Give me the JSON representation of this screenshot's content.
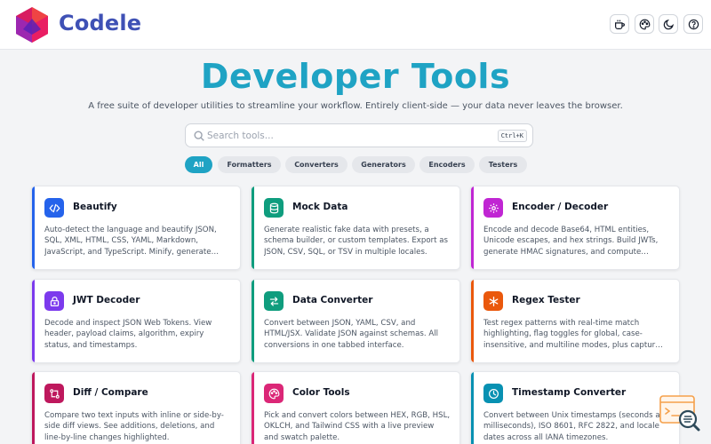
{
  "header": {
    "brand": "Codele",
    "buttons": [
      {
        "icon": "coffee-icon",
        "label": "Buy me a coffee"
      },
      {
        "icon": "palette-icon",
        "label": "Theme"
      },
      {
        "icon": "moon-icon",
        "label": "Dark mode"
      },
      {
        "icon": "help-icon",
        "label": "Help"
      }
    ]
  },
  "hero": {
    "title": "Developer Tools",
    "subtitle": "A free suite of developer utilities to streamline your workflow. Entirely client-side — your data never leaves the browser."
  },
  "search": {
    "placeholder": "Search tools...",
    "value": "",
    "shortcut": "Ctrl+K"
  },
  "filters": [
    {
      "label": "All",
      "active": true
    },
    {
      "label": "Formatters",
      "active": false
    },
    {
      "label": "Converters",
      "active": false
    },
    {
      "label": "Generators",
      "active": false
    },
    {
      "label": "Encoders",
      "active": false
    },
    {
      "label": "Testers",
      "active": false
    }
  ],
  "colors": {
    "brand": "#3f51b5",
    "accent": "#1fa3c4"
  },
  "tools": [
    {
      "name": "Beautify",
      "icon": "code-icon",
      "color": "#2563eb",
      "description": "Auto-detect the language and beautify JSON, SQL, XML, HTML, CSS, YAML, Markdown, JavaScript, and TypeScript. Minify, generate…"
    },
    {
      "name": "Mock Data",
      "icon": "database-icon",
      "color": "#0f9d7e",
      "description": "Generate realistic fake data with presets, a schema builder, or custom templates. Export as JSON, CSV, SQL, or TSV in multiple locales."
    },
    {
      "name": "Encoder / Decoder",
      "icon": "gear-icon",
      "color": "#c026d3",
      "description": "Encode and decode Base64, HTML entities, Unicode escapes, and hex strings. Build JWTs, generate HMAC signatures, and compute…"
    },
    {
      "name": "JWT Decoder",
      "icon": "lock-icon",
      "color": "#7c3aed",
      "description": "Decode and inspect JSON Web Tokens. View header, payload claims, algorithm, expiry status, and timestamps."
    },
    {
      "name": "Data Converter",
      "icon": "swap-icon",
      "color": "#0f9d7e",
      "description": "Convert between JSON, YAML, CSV, and HTML/JSX. Validate JSON against schemas. All conversions in one tabbed interface."
    },
    {
      "name": "Regex Tester",
      "icon": "asterisk-icon",
      "color": "#ea580c",
      "description": "Test regex patterns with real-time match highlighting, flag toggles for global, case-insensitive, and multiline modes, plus captur…"
    },
    {
      "name": "Diff / Compare",
      "icon": "git-compare-icon",
      "color": "#be185d",
      "description": "Compare two text inputs with inline or side-by-side diff views. See additions, deletions, and line-by-line changes highlighted."
    },
    {
      "name": "Color Tools",
      "icon": "palette-icon",
      "color": "#db2777",
      "description": "Pick and convert colors between HEX, RGB, HSL, OKLCH, and Tailwind CSS with a live preview and swatch palette."
    },
    {
      "name": "Timestamp Converter",
      "icon": "clock-icon",
      "color": "#0891b2",
      "description": "Convert between Unix timestamps (seconds and milliseconds), ISO 8601, RFC 2822, and locale dates across all IANA timezones."
    }
  ]
}
